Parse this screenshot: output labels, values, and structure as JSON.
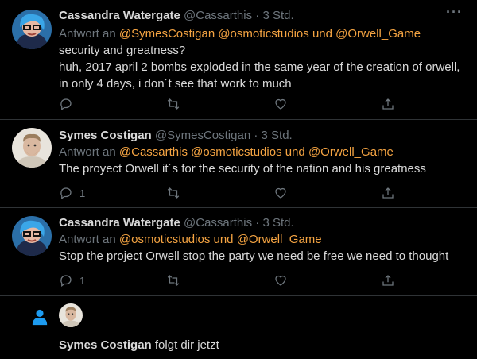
{
  "tweets": [
    {
      "name": "Cassandra Watergate",
      "handle": "@Cassarthis",
      "separator": "·",
      "time": "3 Std.",
      "reply_prefix": "Antwort an",
      "reply_mentions": "@SymesCostigan @osmoticstudios",
      "reply_and": "und",
      "reply_last": "@Orwell_Game",
      "text_lines": [
        "security and greatness?",
        "huh, 2017 april 2 bombs exploded in the same year of the creation of orwell,",
        "in only 4 days, i don´t see that work to much"
      ],
      "reply_count": ""
    },
    {
      "name": "Symes Costigan",
      "handle": "@SymesCostigan",
      "separator": "·",
      "time": "3 Std.",
      "reply_prefix": "Antwort an",
      "reply_mentions": "@Cassarthis @osmoticstudios",
      "reply_and": "und",
      "reply_last": "@Orwell_Game",
      "text_lines": [
        "The proyect Orwell it´s for the security of the nation and his greatness"
      ],
      "reply_count": "1"
    },
    {
      "name": "Cassandra Watergate",
      "handle": "@Cassarthis",
      "separator": "·",
      "time": "3 Std.",
      "reply_prefix": "Antwort an",
      "reply_mentions": "@osmoticstudios",
      "reply_and": "und",
      "reply_last": "@Orwell_Game",
      "text_lines": [
        "Stop the project Orwell stop the party we need be free we need to thought"
      ],
      "reply_count": "1"
    }
  ],
  "follow": {
    "name": "Symes Costigan",
    "text": "folgt dir jetzt"
  },
  "colors": {
    "background": "#000000",
    "accent_mention": "#f5a442",
    "muted": "#6e767d",
    "text": "#d9d9d9",
    "follow_icon": "#1d9bf0"
  }
}
